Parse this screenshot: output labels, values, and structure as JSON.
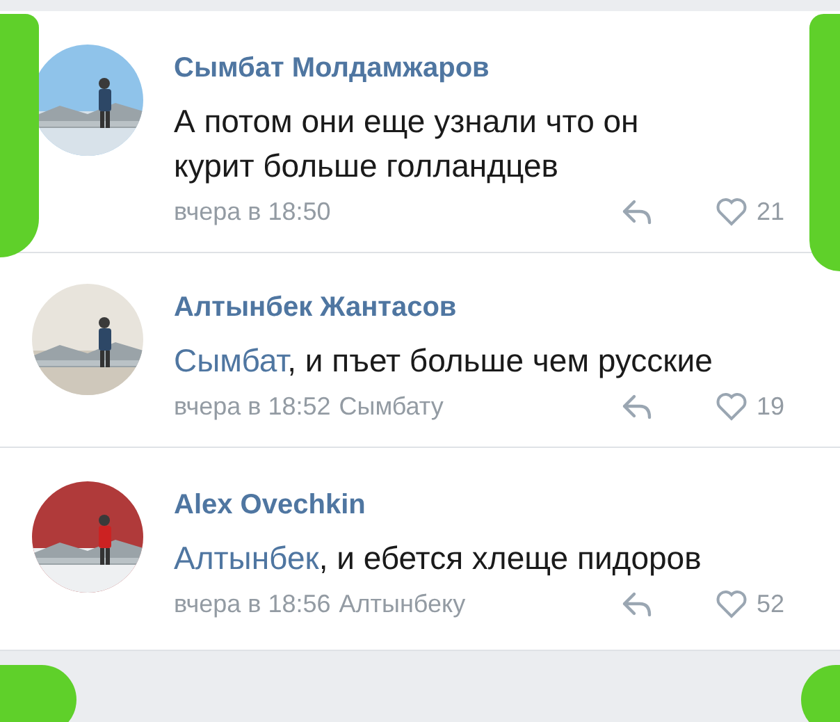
{
  "comments": [
    {
      "author": "Сымбат Молдамжаров",
      "text": "А потом они еще узнали что он курит больше голландцев",
      "time": "вчера в 18:50",
      "likes": "21"
    },
    {
      "author": "Алтынбек Жантасов",
      "mention": "Сымбат",
      "text": ", и пъет больше чем русские",
      "time": "вчера в 18:52",
      "reply_to": "Сымбату",
      "likes": "19"
    },
    {
      "author": "Alex Ovechkin",
      "mention": "Алтынбек",
      "text": ", и ебется хлеще пидоров",
      "time": "вчера в 18:56",
      "reply_to": "Алтынбеку",
      "likes": "52"
    }
  ]
}
